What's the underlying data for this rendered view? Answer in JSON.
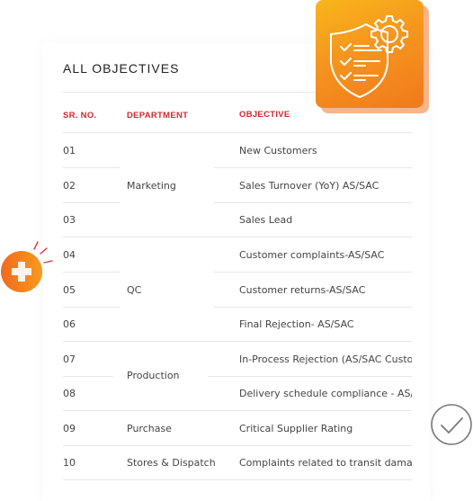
{
  "card": {
    "title": "ALL OBJECTIVES",
    "columns": [
      "SR. NO.",
      "DEPARTMENT",
      "OBJECTIVE"
    ],
    "rows": [
      {
        "no": "01",
        "objective": "New Customers"
      },
      {
        "no": "02",
        "objective": "Sales Turnover (YoY) AS/SAC"
      },
      {
        "no": "03",
        "objective": "Sales Lead"
      },
      {
        "no": "04",
        "objective": "Customer complaints-AS/SAC"
      },
      {
        "no": "05",
        "objective": "Customer returns-AS/SAC"
      },
      {
        "no": "06",
        "objective": "Final Rejection- AS/SAC"
      },
      {
        "no": "07",
        "objective": "In-Process Rejection (AS/SAC Customer)"
      },
      {
        "no": "08",
        "objective": "Delivery schedule compliance - AS/SAC"
      },
      {
        "no": "09",
        "objective": "Critical Supplier Rating"
      },
      {
        "no": "10",
        "objective": "Complaints related to transit damage"
      }
    ],
    "departments": [
      "Marketing",
      "QC",
      "Production",
      "Purchase",
      "Stores & Dispatch"
    ]
  },
  "icons": {
    "badge": "shield-checklist-gear-icon",
    "plus": "plus-circle-icon",
    "check": "check-circle-icon"
  },
  "colors": {
    "header_red": "#d4272f",
    "badge_orange": "#f5951e",
    "badge_shadow": "#f9b48a"
  }
}
